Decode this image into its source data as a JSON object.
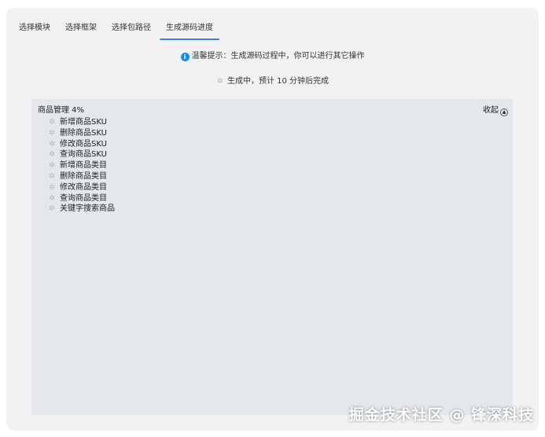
{
  "tabs": [
    {
      "label": "选择模块"
    },
    {
      "label": "选择框架"
    },
    {
      "label": "选择包路径"
    },
    {
      "label": "生成源码进度",
      "active": true
    }
  ],
  "tip": "温馨提示：生成源码过程中，你可以进行其它操作",
  "status": "生成中，预计 10 分钟后完成",
  "panel": {
    "title": "商品管理 4%",
    "collapse_label": "收起",
    "items": [
      "新增商品SKU",
      "删除商品SKU",
      "修改商品SKU",
      "查询商品SKU",
      "新增商品类目",
      "删除商品类目",
      "修改商品类目",
      "查询商品类目",
      "关键字搜索商品"
    ]
  },
  "watermark": "掘金技术社区 @ 锋深科技",
  "colors": {
    "accent": "#3f7ee8",
    "info": "#1a8cf0"
  }
}
